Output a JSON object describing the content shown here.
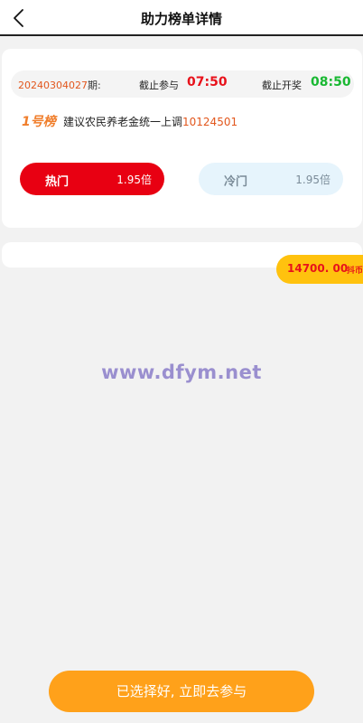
{
  "header": {
    "title": "助力榜单详情",
    "back_icon": "chevron-left-icon"
  },
  "info": {
    "period_number": "20240304027",
    "period_suffix": "期:",
    "deadline_join_label": "截止参与",
    "deadline_join_time": "07:50",
    "deadline_draw_label": "截止开奖",
    "deadline_draw_time": "08:50"
  },
  "board": {
    "label": "1号榜",
    "description": "建议农民养老金统一上调",
    "code": "10124501"
  },
  "options": {
    "hot": {
      "label": "热门",
      "odds": "1.95倍"
    },
    "cold": {
      "label": "冷门",
      "odds": "1.95倍"
    }
  },
  "balance": {
    "amount": "14700. 00",
    "unit": "抖币"
  },
  "watermark": "www.dfym.net",
  "submit": {
    "label": "已选择好, 立即去参与"
  },
  "colors": {
    "hot": "#e80012",
    "cold_bg": "#e6f4fc",
    "accent_orange": "#ffa11a",
    "balance_bg": "#ffc20e",
    "join_time": "#e8121b",
    "draw_time": "#19b832"
  }
}
